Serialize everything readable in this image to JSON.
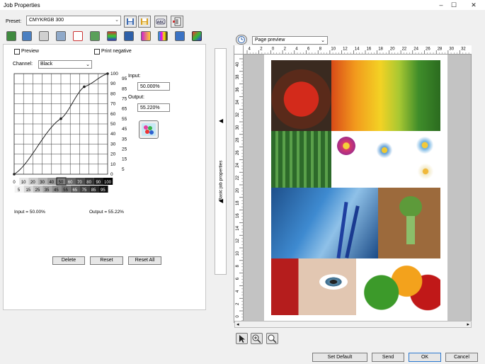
{
  "window": {
    "title": "Job Properties",
    "minimize": "–",
    "maximize": "☐",
    "close": "✕"
  },
  "toolbar": {
    "preset_label": "Preset:",
    "preset_value": "CMYKRGB 300"
  },
  "options": {
    "preview_label": "Preview",
    "print_negative_label": "Print negative"
  },
  "channel": {
    "label": "Channel:",
    "value": "Black"
  },
  "curve": {
    "y_ticks": [
      "100",
      "95",
      "90",
      "85",
      "80",
      "75",
      "70",
      "65",
      "60",
      "55",
      "50",
      "45",
      "40",
      "35",
      "30",
      "25",
      "20",
      "15",
      "10",
      "5",
      "0"
    ],
    "x_ticks_top": [
      "0",
      "10",
      "20",
      "30",
      "40",
      "50",
      "60",
      "70",
      "80",
      "90",
      "100"
    ],
    "x_ticks_bottom": [
      "5",
      "15",
      "25",
      "35",
      "45",
      "55",
      "65",
      "75",
      "85",
      "95"
    ],
    "points": [
      [
        0,
        0
      ],
      [
        50,
        55.22
      ],
      [
        75,
        87
      ],
      [
        100,
        100
      ]
    ]
  },
  "input": {
    "label": "Input:",
    "value": "50.000%"
  },
  "output": {
    "label": "Output:",
    "value": "55.220%"
  },
  "readout": {
    "input": "Input = 50.00%",
    "output": "Output = 55.22%"
  },
  "buttons": {
    "delete": "Delete",
    "reset": "Reset",
    "reset_all": "Reset All"
  },
  "sidebar": {
    "label": "Basic job properties"
  },
  "preview": {
    "mode": "Page preview",
    "ruler_top": [
      "4",
      "2",
      "0",
      "2",
      "4",
      "6",
      "8",
      "10",
      "12",
      "14",
      "16",
      "18",
      "20",
      "22",
      "24",
      "26",
      "28",
      "30",
      "32"
    ],
    "ruler_left": [
      "40",
      "38",
      "36",
      "34",
      "32",
      "30",
      "28",
      "26",
      "24",
      "22",
      "20",
      "18",
      "16",
      "14",
      "12",
      "10",
      "8",
      "6",
      "4",
      "2",
      "0"
    ]
  },
  "footer": {
    "set_default": "Set Default",
    "send": "Send",
    "ok": "OK",
    "cancel": "Cancel"
  }
}
